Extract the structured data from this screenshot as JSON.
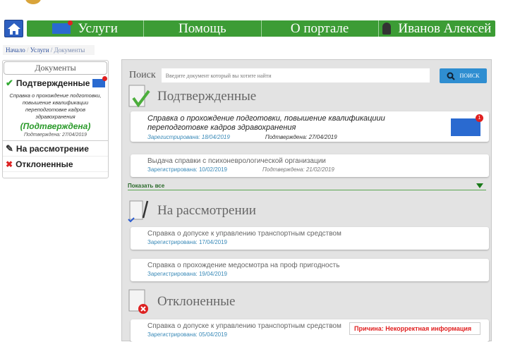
{
  "nav": {
    "items": [
      "Услуги",
      "Помощь",
      "О портале",
      "Иванов Алексей"
    ]
  },
  "breadcrumb": {
    "home": "Начало",
    "sep": "/",
    "services": "Услуги",
    "current": "/ Документы"
  },
  "sidebar": {
    "title": "Документы",
    "confirmed": "Подтвержденные",
    "doc_title": "Справка о прохождение подготовки, повышение квалификации переподготовке кадров здравохранения",
    "doc_status": "(Подтверждена)",
    "doc_date": "Подтверждена: 27/04/2019",
    "review": "На рассмотрение",
    "rejected": "Отклоненные"
  },
  "search": {
    "label": "Поиск",
    "placeholder": "Введите документ который вы хотите найти",
    "button": "ПОИСК"
  },
  "confirmed": {
    "title": "Подтвержденные",
    "items": [
      {
        "title": "Справка о прохождение подготовки, повышение квалификациии переподготовке кадров здравохранения",
        "reg": "Зарегистрирована: 18/04/2019",
        "conf": "Подтверждена: 27/04/2019",
        "badge": "1"
      },
      {
        "title": "Выдача справки с психоневрологической организации",
        "reg": "Зарегистрирована: 10/02/2019",
        "conf": "Подтверждена: 21/02/2019"
      }
    ],
    "show_all": "Показать все"
  },
  "review": {
    "title": "На рассмотрении",
    "items": [
      {
        "title": "Справка о допуске к управлению транспортным средством",
        "reg": "Зарегистрирована: 17/04/2019"
      },
      {
        "title": "Справка  о прохождение медосмотра на проф пригодность",
        "reg": "Зарегистрирована: 19/04/2019"
      }
    ]
  },
  "rejected": {
    "title": "Отклоненные",
    "items": [
      {
        "title": "Справка о допуске к управлению транспортным средством",
        "reg": "Зарегистрирована: 05/04/2019",
        "reason": "Причина: Некорректная информация"
      }
    ]
  }
}
